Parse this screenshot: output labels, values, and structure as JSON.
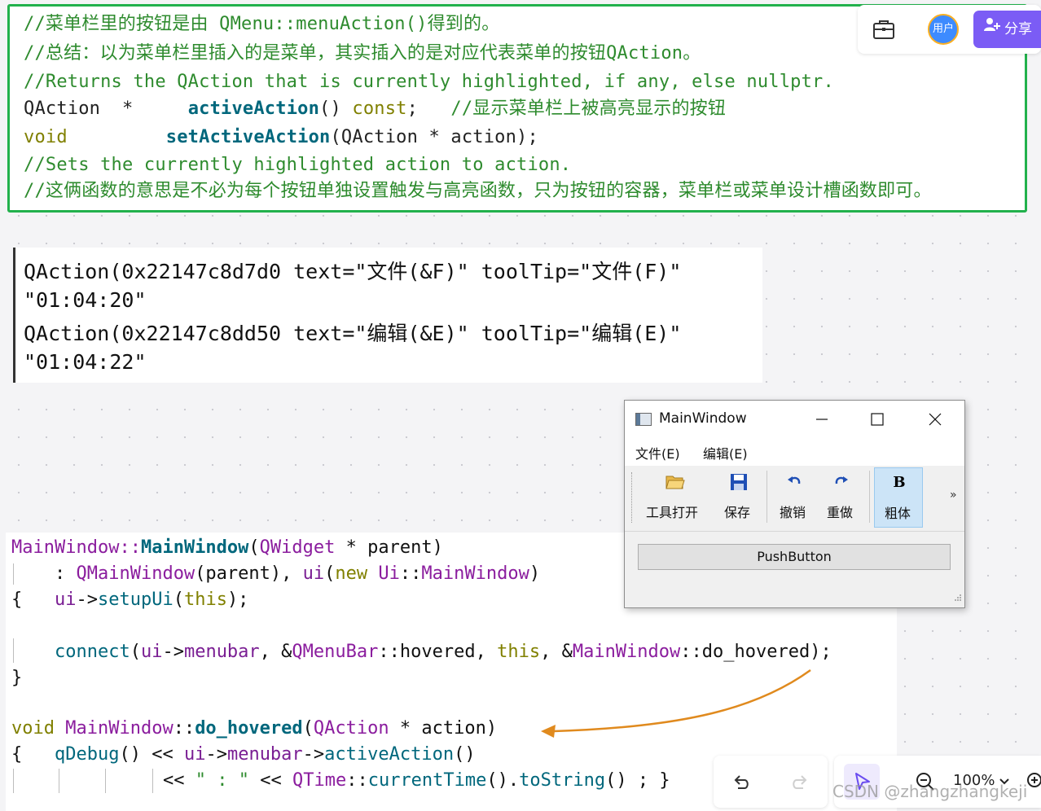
{
  "comment_block": {
    "lines": [
      {
        "parts": [
          "//菜单栏里的按钮是由 QMenu::menuAction()得到的。"
        ]
      },
      {
        "parts": [
          "//总结：以为菜单栏里插入的是菜单，其实插入的是对应代表菜单的按钮QAction。"
        ]
      },
      {
        "parts": [
          "//Returns the QAction that is currently highlighted, if any, else nullptr."
        ]
      },
      {
        "parts": [
          "QAction  *     ",
          "activeAction",
          "() ",
          "const",
          ";   ",
          "//显示菜单栏上被高亮显示的按钮"
        ]
      },
      {
        "parts": [
          "void         ",
          "setActiveAction",
          "(QAction * action);"
        ]
      },
      {
        "parts": [
          "//Sets the currently highlighted action to action."
        ]
      },
      {
        "parts": [
          "//这俩函数的意思是不必为每个按钮单独设置触发与高亮函数，只为按钮的容器，菜单栏或菜单设计槽函数即可。"
        ]
      }
    ]
  },
  "top_toolbar": {
    "avatar_label": "用户",
    "share_label": "分享"
  },
  "debug_output": {
    "lines": [
      "QAction(0x22147c8d7d0 text=\"文件(&F)\" toolTip=\"文件(F)\"",
      "\"01:04:20\"",
      "QAction(0x22147c8dd50 text=\"编辑(&E)\" toolTip=\"编辑(E)\"",
      "\"01:04:22\""
    ]
  },
  "code": {
    "l1": [
      "MainWindow::",
      "MainWindow",
      "(",
      "QWidget",
      " * parent)"
    ],
    "l2": [
      "    : ",
      "QMainWindow",
      "(parent), ",
      "ui",
      "(",
      "new",
      " ",
      "Ui",
      "::",
      "MainWindow",
      ")"
    ],
    "l3": [
      "{   ",
      "ui",
      "->",
      "setupUi",
      "(",
      "this",
      ");"
    ],
    "l5": [
      "    ",
      "connect",
      "(",
      "ui",
      "->",
      "menubar",
      ", &",
      "QMenuBar",
      "::hovered, ",
      "this",
      ", &",
      "MainWindow",
      "::do_hovered);"
    ],
    "l6": "}",
    "l8": [
      "void",
      " ",
      "MainWindow",
      "::",
      "do_hovered",
      "(",
      "QAction",
      " * action)"
    ],
    "l9": [
      "{   ",
      "qDebug",
      "() << ",
      "ui",
      "->",
      "menubar",
      "->",
      "activeAction",
      "()"
    ],
    "l10": [
      "<< ",
      "\" : \"",
      " << ",
      "QTime",
      "::",
      "currentTime",
      "().",
      "toString",
      "() ; }"
    ]
  },
  "main_window": {
    "title": "MainWindow",
    "menus": [
      "文件(E)",
      "编辑(E)"
    ],
    "toolbar": [
      {
        "label": "工具打开",
        "icon": "folder-open-icon"
      },
      {
        "label": "保存",
        "icon": "save-icon"
      },
      {
        "label": "撤销",
        "icon": "undo-icon"
      },
      {
        "label": "重做",
        "icon": "redo-icon"
      },
      {
        "label": "粗体",
        "icon": "bold-icon"
      }
    ],
    "overflow": "»",
    "bold_glyph": "B",
    "push_button": "PushButton"
  },
  "bottom_toolbar": {
    "zoom": "100%"
  },
  "watermark": "CSDN @zhangzhangkeji",
  "colors": {
    "comment": "#2e8b2e",
    "keyword": "#808000",
    "function": "#00677c",
    "type": "#8b1d9e",
    "green_border": "#22b14c",
    "accent": "#7b5cf5",
    "arrow": "#e08a1e"
  }
}
